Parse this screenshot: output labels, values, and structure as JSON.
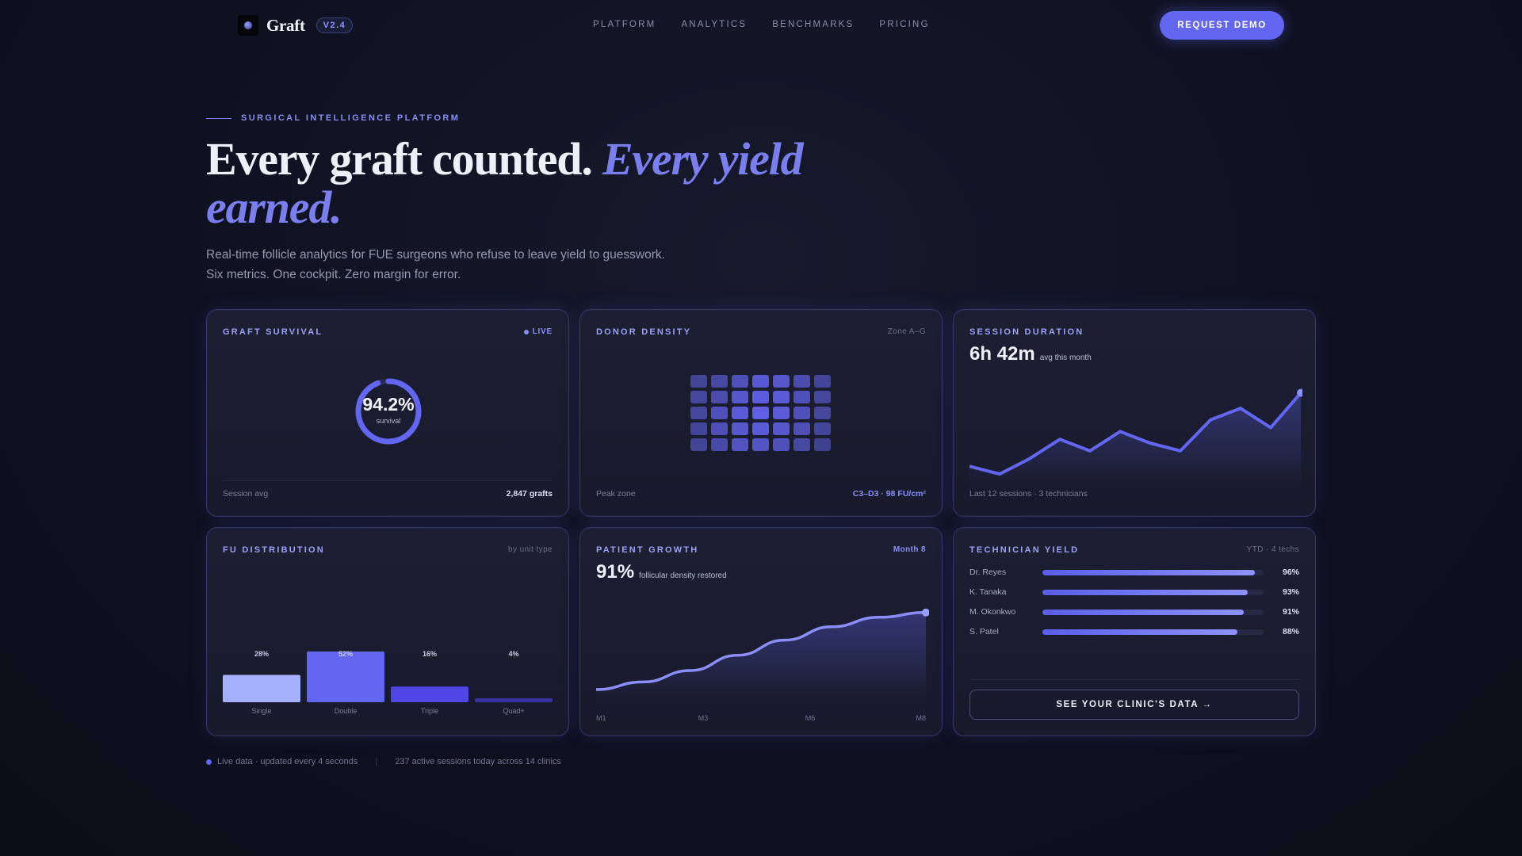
{
  "nav": {
    "brand": "Graft",
    "version": "V2.4",
    "links": [
      "PLATFORM",
      "ANALYTICS",
      "BENCHMARKS",
      "PRICING"
    ],
    "cta": "REQUEST DEMO"
  },
  "hero": {
    "eyebrow": "SURGICAL INTELLIGENCE PLATFORM",
    "headline_plain": "Every graft counted.",
    "headline_accent": "Every yield earned.",
    "sub_line1": "Real-time follicle analytics for FUE surgeons who refuse to leave yield to guesswork.",
    "sub_line2": "Six metrics. One cockpit. Zero margin for error."
  },
  "cards": {
    "survival": {
      "title": "GRAFT SURVIVAL",
      "badge": "LIVE",
      "value": "94.2%",
      "value_label": "survival",
      "progress": 0.942,
      "foot_left": "Session avg",
      "foot_right": "2,847 grafts"
    },
    "density": {
      "title": "DONOR DENSITY",
      "tag": "Zone A–G",
      "foot_left": "Peak zone",
      "foot_right": "C3–D3 · 98 FU/cm²",
      "grid": [
        [
          0.25,
          0.35,
          0.55,
          0.75,
          0.7,
          0.45,
          0.28
        ],
        [
          0.3,
          0.45,
          0.7,
          0.85,
          0.8,
          0.55,
          0.3
        ],
        [
          0.3,
          0.55,
          0.8,
          0.9,
          0.8,
          0.55,
          0.3
        ],
        [
          0.28,
          0.5,
          0.7,
          0.8,
          0.7,
          0.5,
          0.28
        ],
        [
          0.25,
          0.4,
          0.6,
          0.65,
          0.55,
          0.35,
          0.2
        ]
      ]
    },
    "session": {
      "title": "SESSION DURATION",
      "value": "6h 42m",
      "unit": "avg this month",
      "foot_left": "Last 12 sessions · 3 technicians"
    },
    "fu": {
      "title": "FU DISTRIBUTION",
      "tag": "by unit type"
    },
    "growth": {
      "title": "PATIENT GROWTH",
      "tag": "Month 8",
      "value": "91%",
      "unit": "follicular density restored"
    },
    "techs": {
      "title": "TECHNICIAN YIELD",
      "tag": "YTD · 4 techs",
      "rows": [
        {
          "name": "Dr. Reyes",
          "pct": "96%",
          "value": 0.96
        },
        {
          "name": "K. Tanaka",
          "pct": "93%",
          "value": 0.93
        },
        {
          "name": "M. Okonkwo",
          "pct": "91%",
          "value": 0.91
        },
        {
          "name": "S. Patel",
          "pct": "88%",
          "value": 0.88
        }
      ],
      "button": "SEE YOUR CLINIC'S DATA →"
    }
  },
  "chart_data": [
    {
      "type": "line",
      "title": "SESSION DURATION",
      "x": [
        1,
        2,
        3,
        4,
        5,
        6,
        7,
        8,
        9,
        10,
        11,
        12
      ],
      "series": [
        {
          "values": [
            3,
            1,
            5,
            10,
            7,
            12,
            9,
            7,
            15,
            18,
            13,
            22
          ]
        }
      ],
      "ylim": [
        0,
        25
      ],
      "color": "#6366f1"
    },
    {
      "type": "bar",
      "title": "FU DISTRIBUTION",
      "categories": [
        "Single",
        "Double",
        "Triple",
        "Quad+"
      ],
      "values": [
        28,
        52,
        16,
        4
      ],
      "labels": [
        "28%",
        "52%",
        "16%",
        "4%"
      ],
      "ylim": [
        0,
        52
      ],
      "colors": [
        "#a5b0ff",
        "#6366f1",
        "#4f46e5",
        "#3730a3"
      ]
    },
    {
      "type": "area",
      "title": "PATIENT GROWTH",
      "x": [
        1,
        2,
        3,
        4,
        5,
        6,
        7,
        8
      ],
      "tick_labels": [
        "M1",
        "M3",
        "M6",
        "M8"
      ],
      "series": [
        {
          "values": [
            10,
            18,
            30,
            46,
            62,
            76,
            86,
            91
          ]
        }
      ],
      "ylim": [
        0,
        100
      ],
      "color": "#8b8ef7"
    }
  ],
  "status": {
    "left": "Live data · updated every 4 seconds",
    "right": "237 active sessions today across 14 clinics"
  }
}
